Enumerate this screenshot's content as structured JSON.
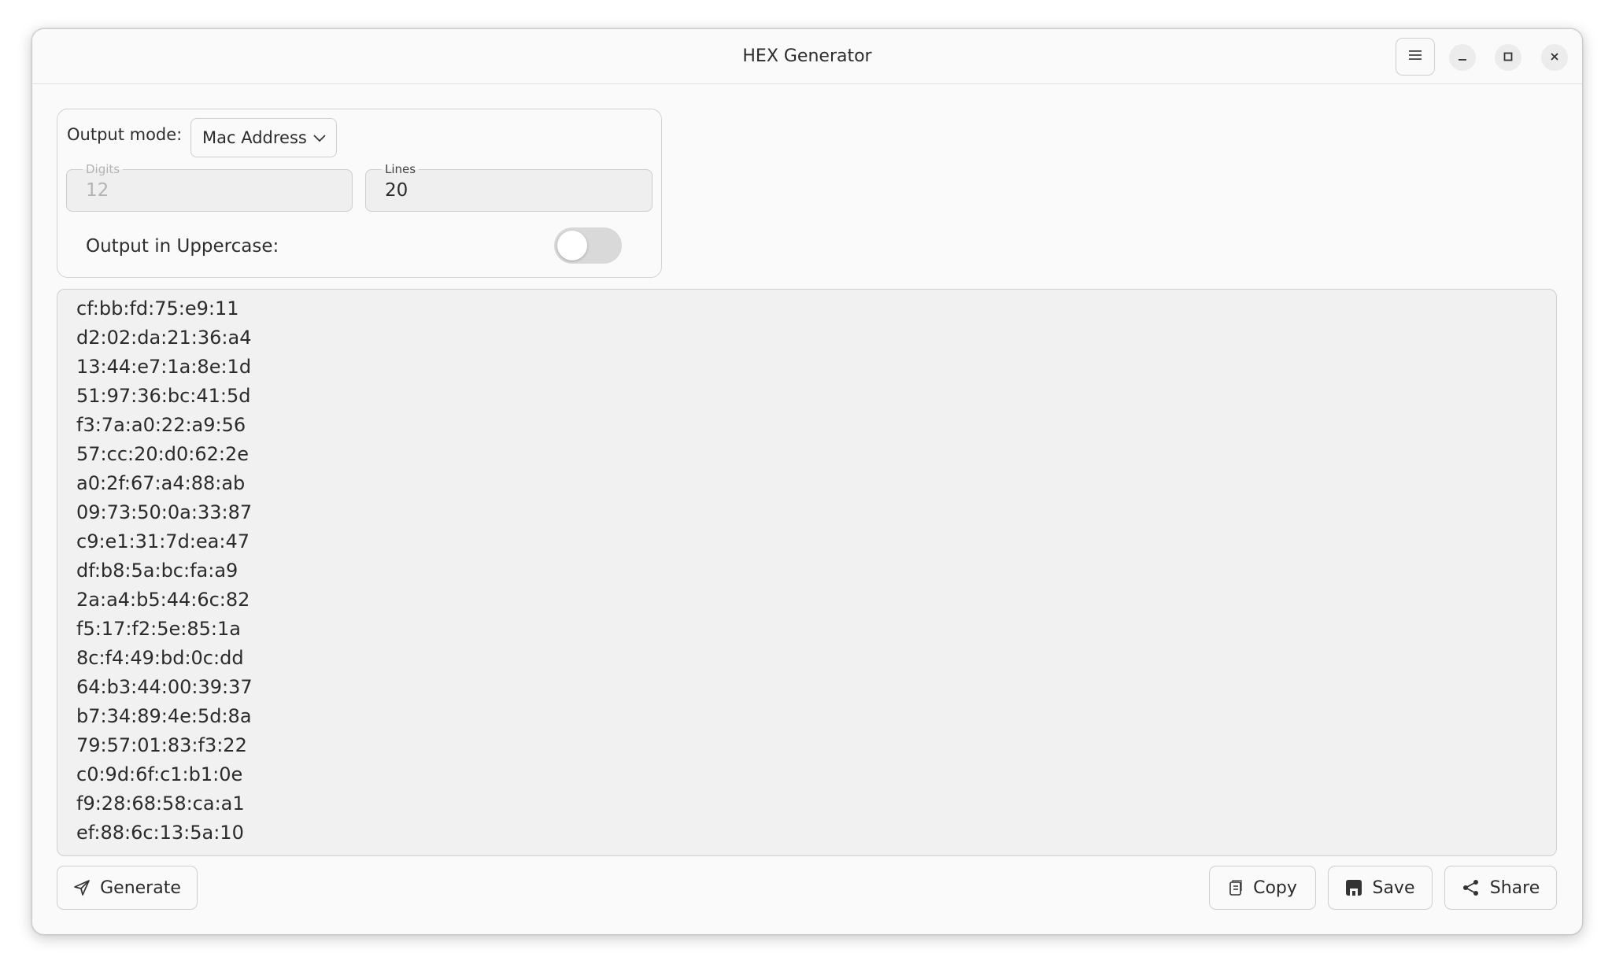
{
  "window": {
    "title": "HEX Generator"
  },
  "titlebar_icons": {
    "menu": "hamburger-menu-icon",
    "minimize": "minimize-icon",
    "maximize": "maximize-icon",
    "close": "close-icon"
  },
  "settings": {
    "output_mode_label": "Output mode:",
    "output_mode_value": "Mac Address",
    "digits_label": "Digits",
    "digits_value": "12",
    "lines_label": "Lines",
    "lines_value": "20",
    "uppercase_label": "Output in Uppercase:",
    "uppercase_enabled": false
  },
  "output": {
    "lines": [
      "cf:bb:fd:75:e9:11",
      "d2:02:da:21:36:a4",
      "13:44:e7:1a:8e:1d",
      "51:97:36:bc:41:5d",
      "f3:7a:a0:22:a9:56",
      "57:cc:20:d0:62:2e",
      "a0:2f:67:a4:88:ab",
      "09:73:50:0a:33:87",
      "c9:e1:31:7d:ea:47",
      "df:b8:5a:bc:fa:a9",
      "2a:a4:b5:44:6c:82",
      "f5:17:f2:5e:85:1a",
      "8c:f4:49:bd:0c:dd",
      "64:b3:44:00:39:37",
      "b7:34:89:4e:5d:8a",
      "79:57:01:83:f3:22",
      "c0:9d:6f:c1:b1:0e",
      "f9:28:68:58:ca:a1",
      "ef:88:6c:13:5a:10"
    ]
  },
  "actions": {
    "generate_label": "Generate",
    "copy_label": "Copy",
    "save_label": "Save",
    "share_label": "Share"
  },
  "colors": {
    "window_bg": "#fafafa",
    "output_bg": "#f1f1f1",
    "toggle_off": "#d9d9d9",
    "text": "#2b2b2b",
    "disabled_text": "#b3b3b3"
  }
}
